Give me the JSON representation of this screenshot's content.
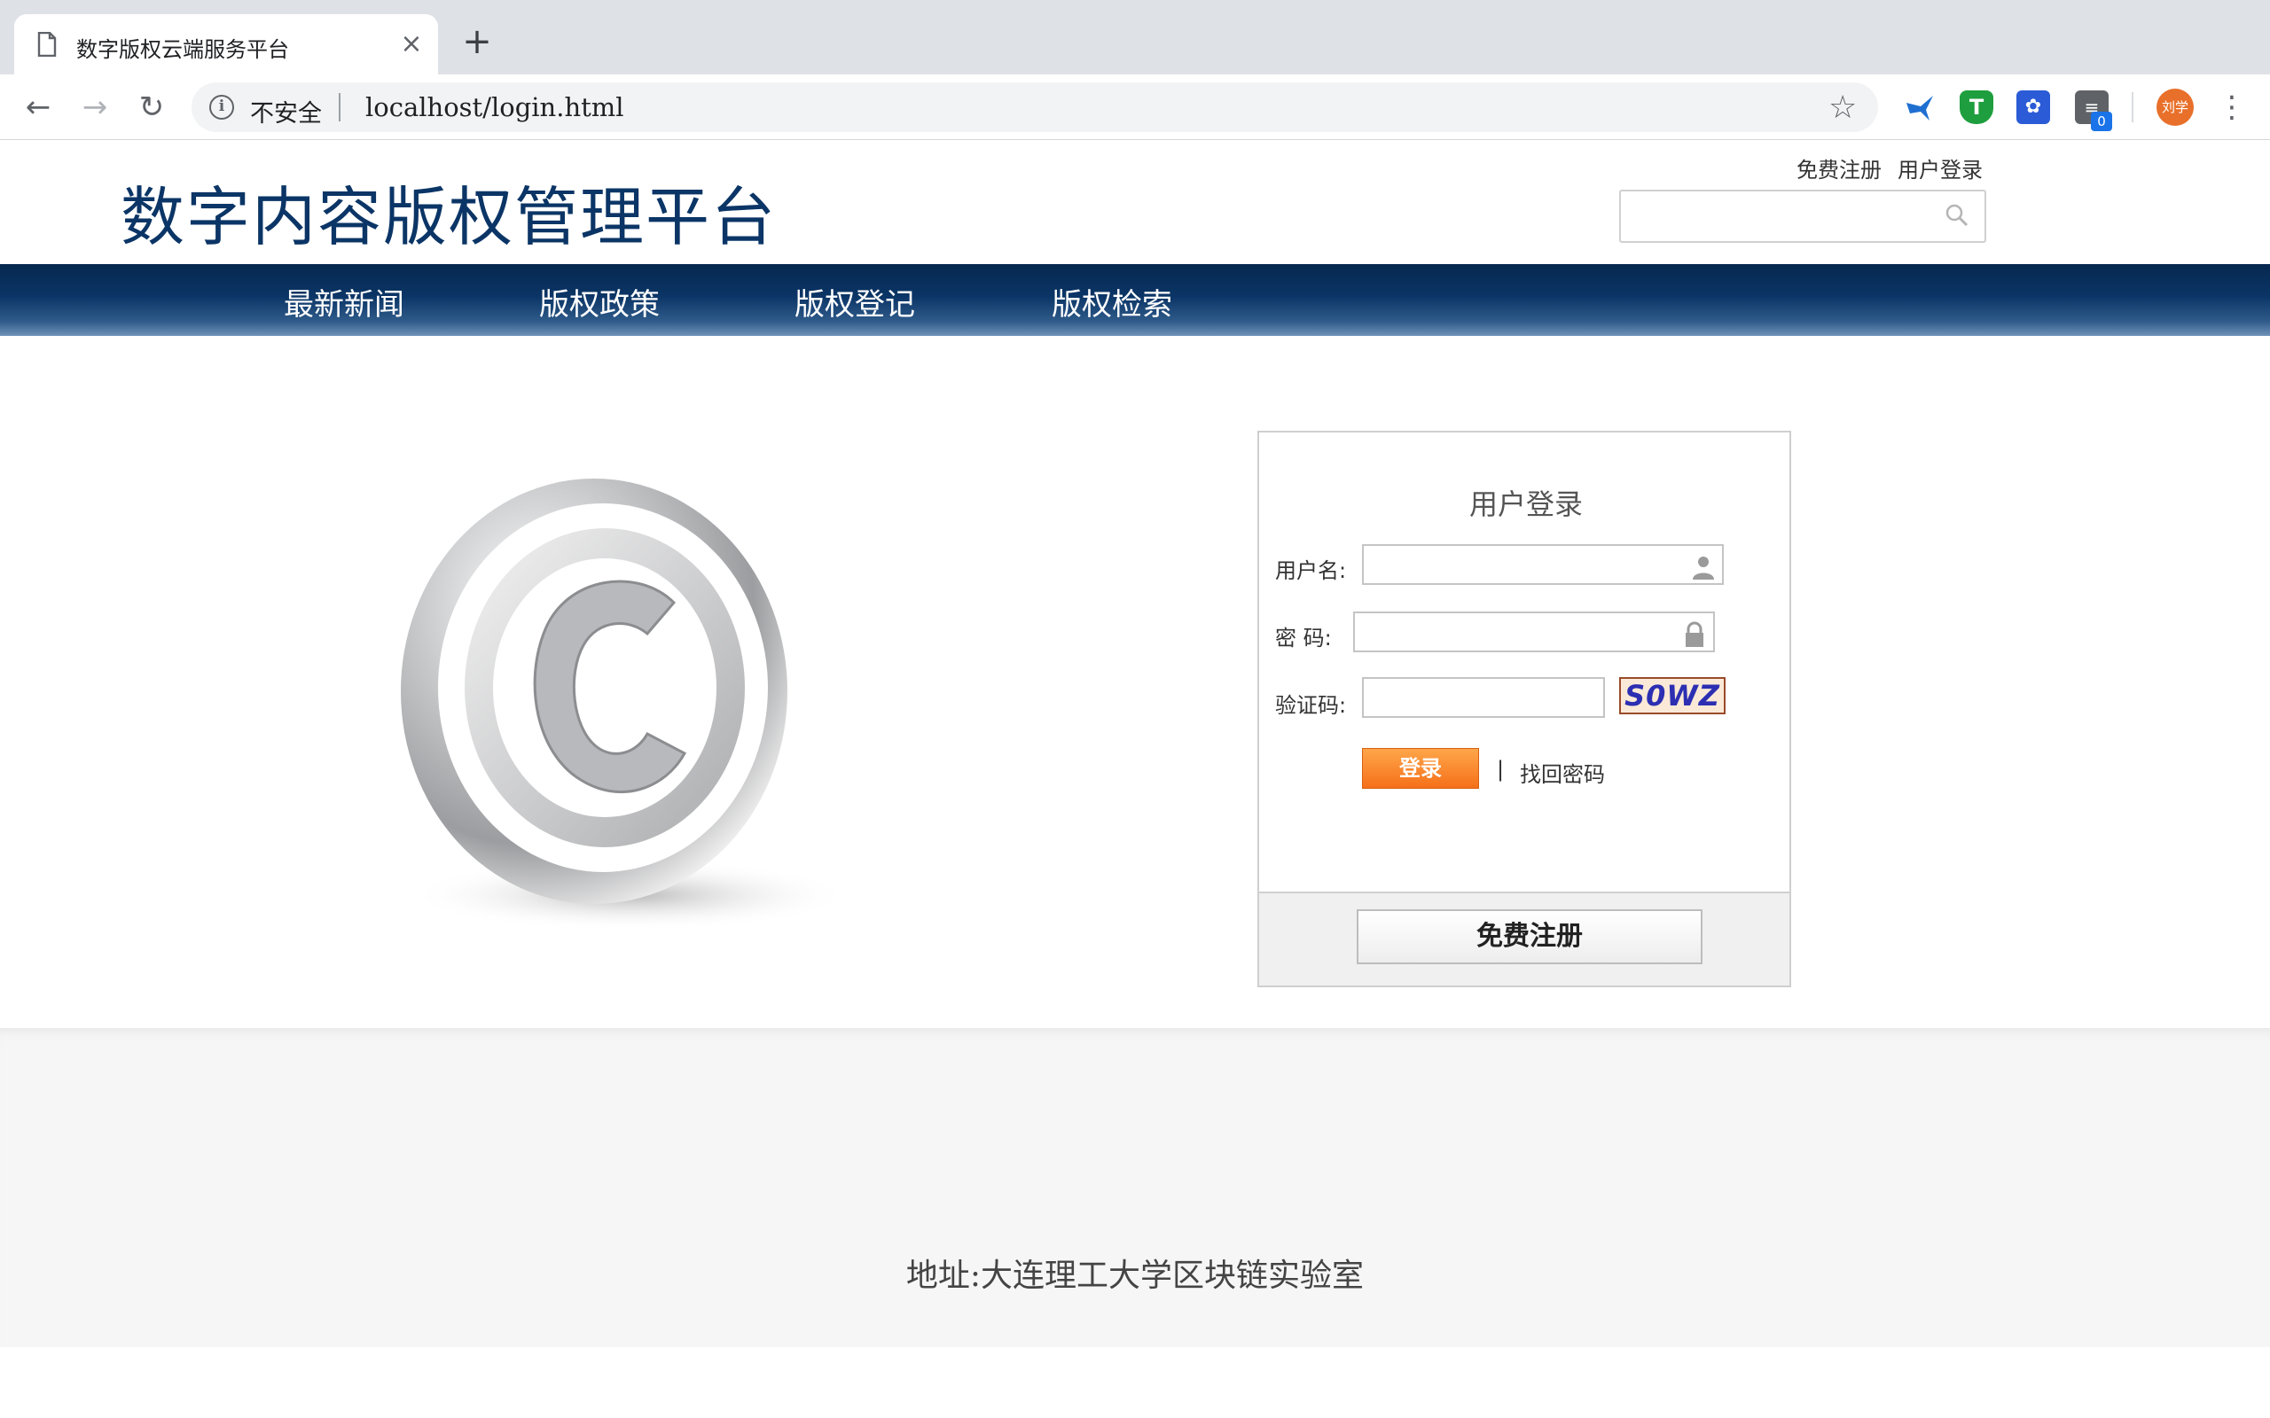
{
  "browser": {
    "tab_title": "数字版权云端服务平台",
    "tab_close": "×",
    "new_tab": "+",
    "security_label": "不安全",
    "url": "localhost/login.html",
    "extension_badge": "0",
    "avatar_text": "刘学"
  },
  "header": {
    "site_title": "数字内容版权管理平台",
    "top_links": [
      "免费注册",
      "用户登录"
    ],
    "search": {
      "placeholder": ""
    }
  },
  "nav": {
    "items": [
      "最新新闻",
      "版权政策",
      "版权登记",
      "版权检索"
    ],
    "colors": {
      "bar": "#0b3566",
      "text": "#ffffff"
    }
  },
  "login": {
    "title": "用户登录",
    "username_label": "用户名:",
    "password_label": "密  码:",
    "captcha_label": "验证码:",
    "captcha_text": "S0WZ",
    "login_button": "登录",
    "separator": "|",
    "find_password": "找回密码",
    "register_button": "免费注册",
    "colors": {
      "login_button": "#f5701a"
    }
  },
  "footer": {
    "address": "地址:大连理工大学区块链实验室"
  }
}
